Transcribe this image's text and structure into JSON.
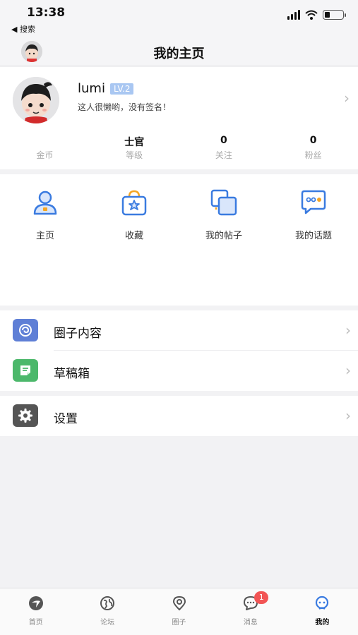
{
  "status": {
    "time": "13:38",
    "back_app": "◀ 搜索",
    "battery_level": 0.3
  },
  "navbar": {
    "title": "我的主页"
  },
  "profile": {
    "username": "lumi",
    "level": "LV.2",
    "signature": "这人很懒哟，没有签名！",
    "stats": [
      {
        "value": "",
        "label": "金币"
      },
      {
        "value": "士官",
        "label": "等级"
      },
      {
        "value": "0",
        "label": "关注"
      },
      {
        "value": "0",
        "label": "粉丝"
      }
    ]
  },
  "quick_actions": [
    {
      "label": "主页",
      "icon": "person-icon"
    },
    {
      "label": "收藏",
      "icon": "bag-star-icon"
    },
    {
      "label": "我的帖子",
      "icon": "posts-icon"
    },
    {
      "label": "我的话题",
      "icon": "chat-bubble-icon"
    }
  ],
  "menu": {
    "circle_content": "圈子内容",
    "drafts": "草稿箱",
    "settings": "设置"
  },
  "tabbar": {
    "items": [
      {
        "label": "首页",
        "icon": "home-logo-icon"
      },
      {
        "label": "论坛",
        "icon": "globe-icon"
      },
      {
        "label": "圈子",
        "icon": "location-pin-icon"
      },
      {
        "label": "消息",
        "icon": "message-icon",
        "badge": "1"
      },
      {
        "label": "我的",
        "icon": "me-icon"
      }
    ],
    "active": "我的"
  },
  "colors": {
    "accent_blue": "#3a7be0",
    "orange": "#f5a623",
    "badge_red": "#f25555",
    "circle_icon_bg": "#5f7fd6",
    "draft_icon_bg": "#4cb86b",
    "settings_icon_bg": "#555555"
  }
}
